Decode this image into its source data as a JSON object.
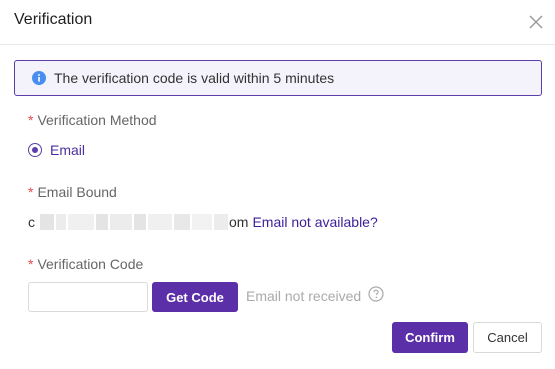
{
  "dialog": {
    "title": "Verification",
    "close_icon": "close-icon"
  },
  "alert": {
    "icon": "info-icon",
    "message": "The verification code is valid within 5 minutes"
  },
  "form": {
    "required_mark": "*",
    "method": {
      "label": "Verification Method",
      "option_label": "Email",
      "selected": true
    },
    "email_bound": {
      "label": "Email Bound",
      "masked_prefix": "c",
      "masked_suffix": "om",
      "link_text": "Email not available?"
    },
    "code": {
      "label": "Verification Code",
      "value": "",
      "placeholder": "",
      "get_code_label": "Get Code",
      "hint": "Email not received",
      "help_icon": "question-circle-icon"
    }
  },
  "footer": {
    "confirm_label": "Confirm",
    "cancel_label": "Cancel"
  },
  "colors": {
    "accent": "#5b2fa8",
    "link": "#3d1e9a",
    "required": "#e84a4a",
    "alert_bg": "#f4f3fc",
    "info_icon": "#4a8df0"
  }
}
